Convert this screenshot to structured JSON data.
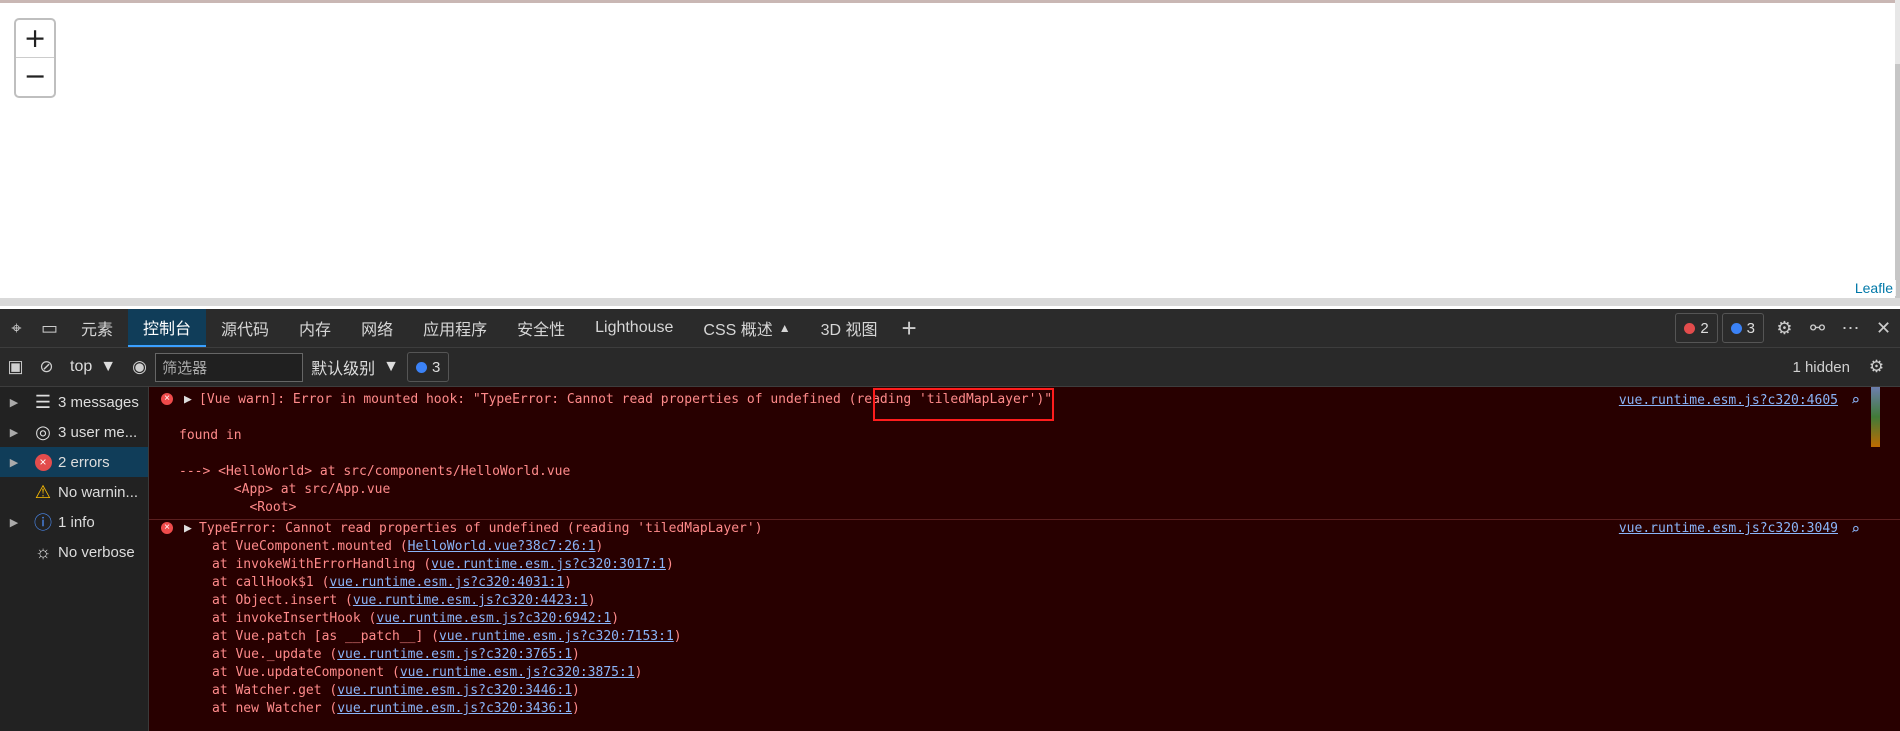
{
  "map": {
    "zoom_in": "+",
    "zoom_out": "−",
    "attribution": "Leafle"
  },
  "devtools": {
    "tabs": [
      "元素",
      "控制台",
      "源代码",
      "内存",
      "网络",
      "应用程序",
      "安全性",
      "Lighthouse",
      "CSS 概述",
      "3D 视图"
    ],
    "error_count": "2",
    "message_count": "3",
    "toolbar": {
      "context": "top",
      "filter_placeholder": "筛选器",
      "level": "默认级别",
      "issues_count": "3",
      "hidden": "1 hidden"
    },
    "sidebar": [
      "3 messages",
      "3 user me...",
      "2 errors",
      "No warnin...",
      "1 info",
      "No verbose"
    ],
    "console": {
      "warn": "[Vue warn]: Error in mounted hook: \"TypeError: Cannot read properties of undefined (reading 'tiledMapLayer')\"",
      "found": "found in",
      "trace1": "---> <HelloWorld> at src/components/HelloWorld.vue",
      "trace2": "       <App> at src/App.vue",
      "trace3": "         <Root>",
      "source1": "vue.runtime.esm.js?c320:4605",
      "type_error": "TypeError: Cannot read properties of undefined (reading 'tiledMapLayer')",
      "source2": "vue.runtime.esm.js?c320:3049",
      "stack": [
        [
          "at VueComponent.mounted (",
          "HelloWorld.vue?38c7:26:1",
          ")"
        ],
        [
          "at invokeWithErrorHandling (",
          "vue.runtime.esm.js?c320:3017:1",
          ")"
        ],
        [
          "at callHook$1 (",
          "vue.runtime.esm.js?c320:4031:1",
          ")"
        ],
        [
          "at Object.insert (",
          "vue.runtime.esm.js?c320:4423:1",
          ")"
        ],
        [
          "at invokeInsertHook (",
          "vue.runtime.esm.js?c320:6942:1",
          ")"
        ],
        [
          "at Vue.patch [as __patch__] (",
          "vue.runtime.esm.js?c320:7153:1",
          ")"
        ],
        [
          "at Vue._update (",
          "vue.runtime.esm.js?c320:3765:1",
          ")"
        ],
        [
          "at Vue.updateComponent (",
          "vue.runtime.esm.js?c320:3875:1",
          ")"
        ],
        [
          "at Watcher.get (",
          "vue.runtime.esm.js?c320:3446:1",
          ")"
        ],
        [
          "at new Watcher (",
          "vue.runtime.esm.js?c320:3436:1",
          ")"
        ]
      ]
    }
  }
}
